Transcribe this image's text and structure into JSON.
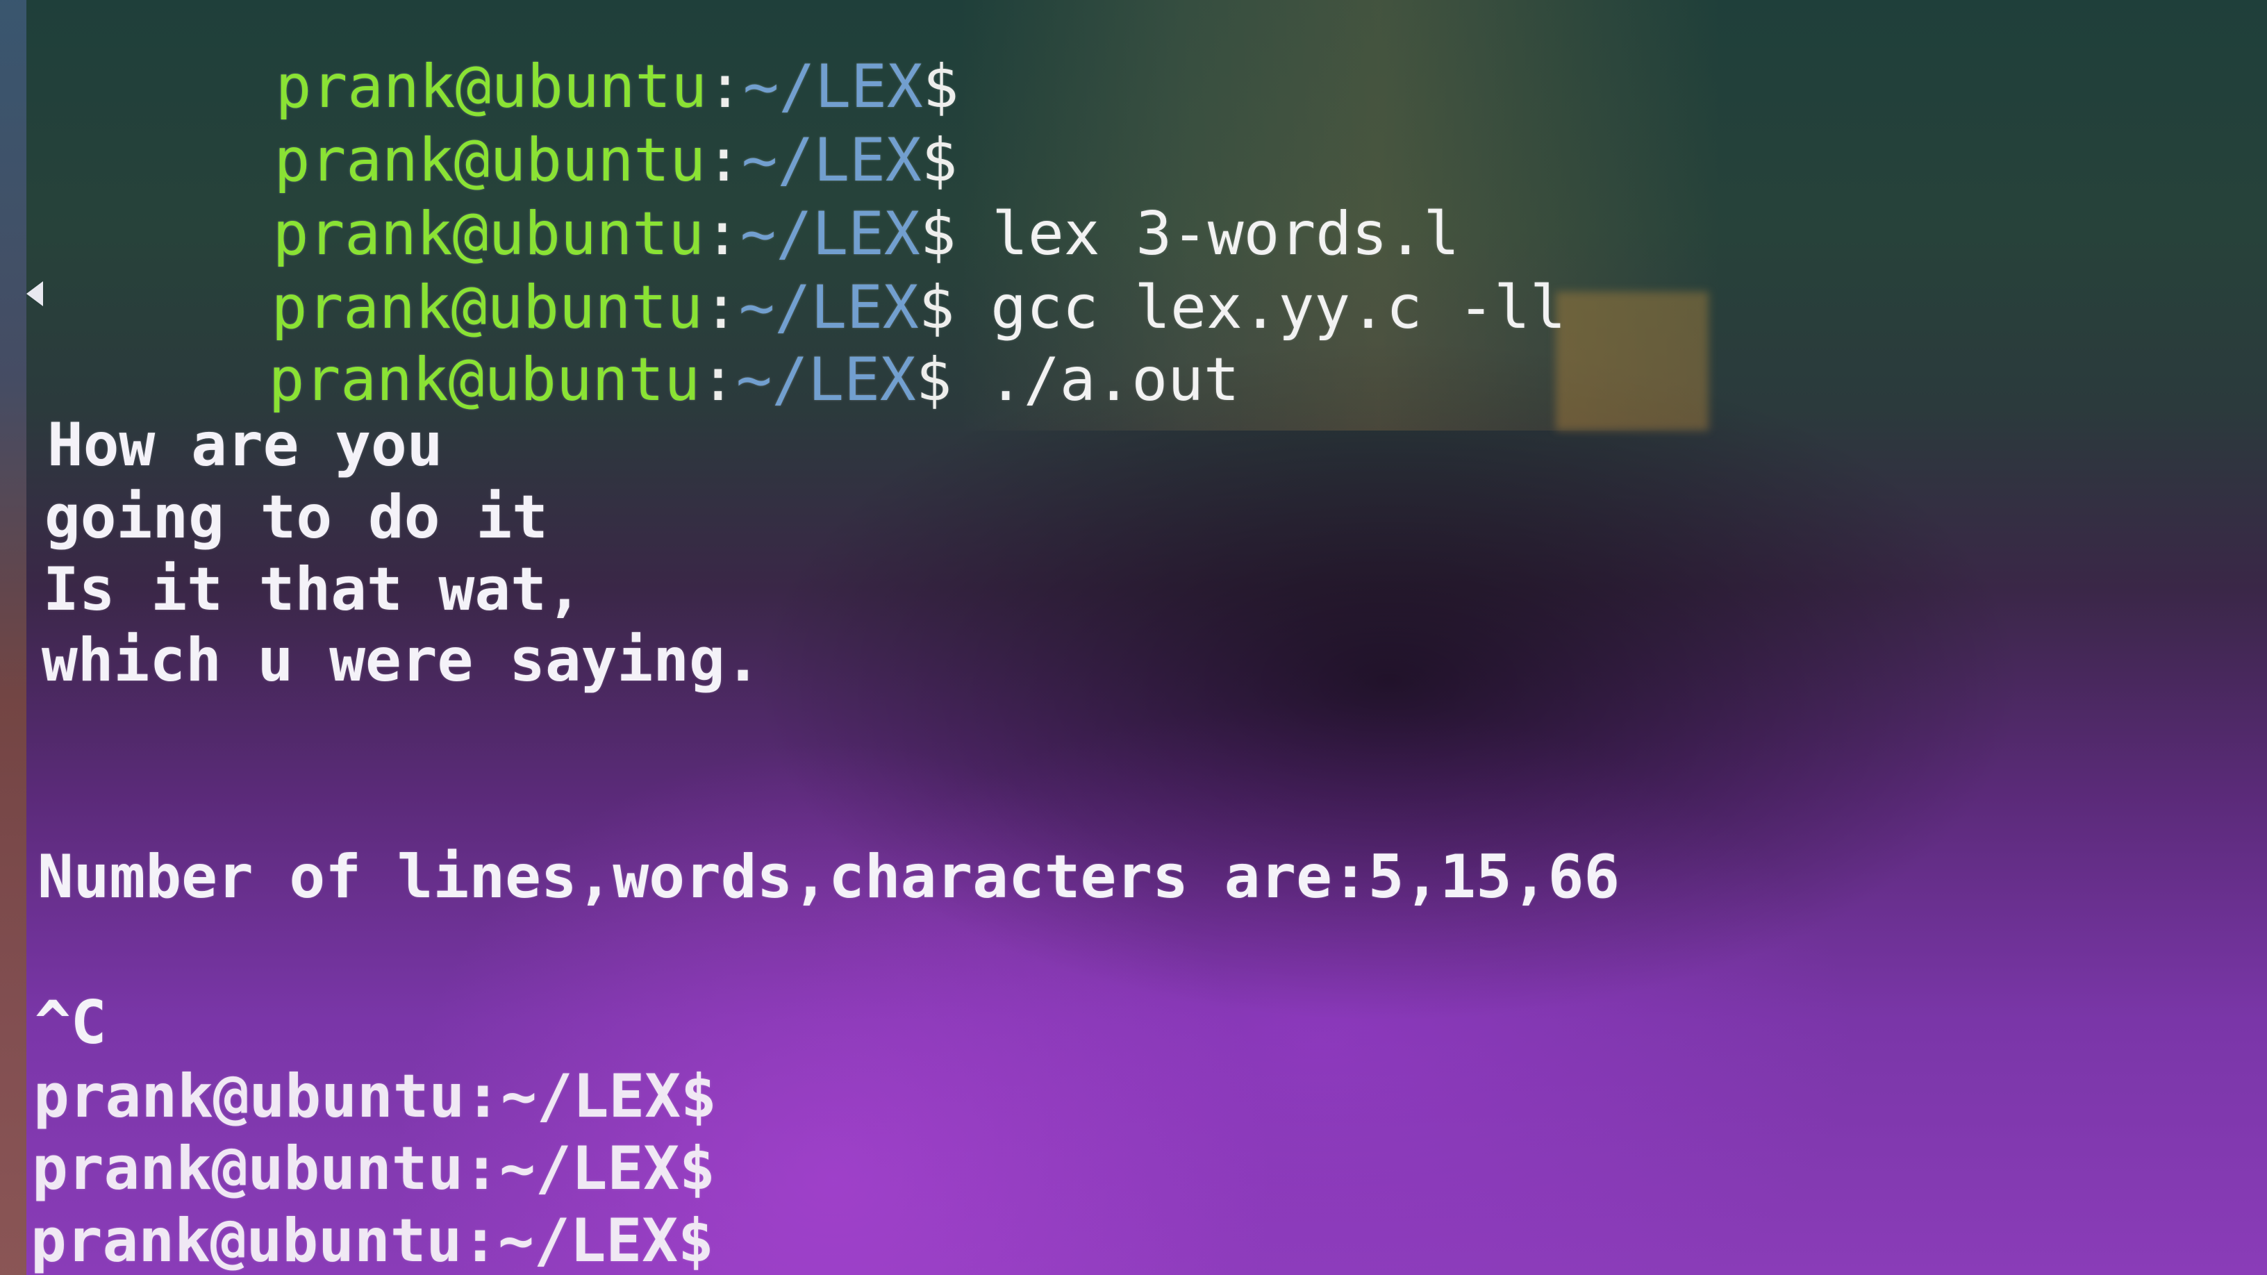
{
  "terminal": {
    "prompt": {
      "user_host": "prank@ubuntu",
      "colon": ":",
      "path": "~/LEX",
      "dollar": "$"
    },
    "command_lines": [
      {
        "command": ""
      },
      {
        "command": ""
      },
      {
        "command": " lex 3-words.l"
      },
      {
        "command": " gcc lex.yy.c -ll"
      },
      {
        "command": " ./a.out"
      }
    ],
    "input_lines": [
      "How are you",
      "going to do it",
      "Is it that wat,",
      "which u were saying."
    ],
    "result": "Number of lines,words,characters are:5,15,66",
    "interrupt": "^C",
    "trailing_prompts": [
      "prank@ubuntu:~/LEX$",
      "prank@ubuntu:~/LEX$",
      "prank@ubuntu:~/LEX$"
    ]
  },
  "colors": {
    "user_host": "#8ae234",
    "path": "#729fcf",
    "text": "#eeeeec",
    "background_purple": "#7a36a8"
  }
}
